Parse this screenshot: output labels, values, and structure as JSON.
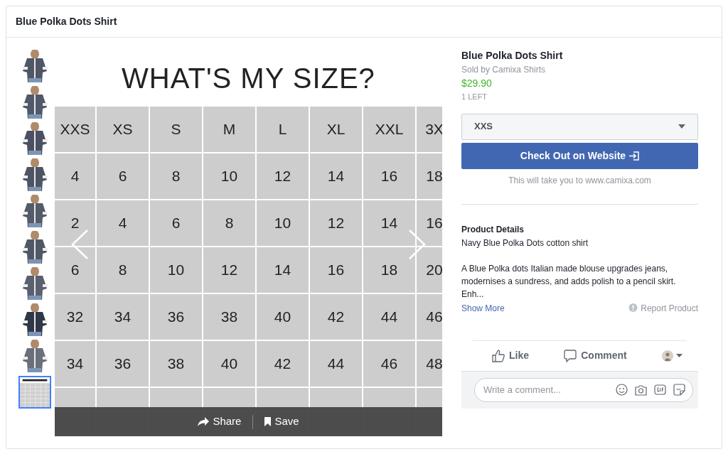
{
  "panel": {
    "title": "Blue Polka Dots Shirt"
  },
  "thumbnails": [
    {
      "kind": "picture",
      "selected": false
    },
    {
      "kind": "picture",
      "selected": false
    },
    {
      "kind": "picture",
      "selected": false
    },
    {
      "kind": "picture",
      "selected": false
    },
    {
      "kind": "picture",
      "selected": false
    },
    {
      "kind": "picture",
      "selected": false
    },
    {
      "kind": "picture",
      "selected": false
    },
    {
      "kind": "picture",
      "selected": false
    },
    {
      "kind": "picture",
      "selected": false
    },
    {
      "kind": "picture",
      "selected": true
    }
  ],
  "size_chart": {
    "title": "WHAT'S MY SIZE?",
    "rows": [
      [
        "XXS",
        "XS",
        "S",
        "M",
        "L",
        "XL",
        "XXL",
        "3X"
      ],
      [
        "4",
        "6",
        "8",
        "10",
        "12",
        "14",
        "16",
        "18"
      ],
      [
        "2",
        "4",
        "6",
        "8",
        "10",
        "12",
        "14",
        "16"
      ],
      [
        "6",
        "8",
        "10",
        "12",
        "14",
        "16",
        "18",
        "20"
      ],
      [
        "32",
        "34",
        "36",
        "38",
        "40",
        "42",
        "44",
        "46"
      ],
      [
        "34",
        "36",
        "38",
        "40",
        "42",
        "44",
        "46",
        "48"
      ]
    ]
  },
  "image_actions": [
    "Share",
    "Save"
  ],
  "product": {
    "name": "Blue Polka Dots Shirt",
    "seller": "Sold by Camixa Shirts",
    "price": "$29.90",
    "stock": "1 LEFT",
    "size_select": "XXS",
    "checkout_button": "Check Out on Website",
    "checkout_note": "This will take you to www.camixa.com",
    "details_heading": "Product Details",
    "details_subtitle": "Navy Blue Polka Dots cotton shirt",
    "description": "A Blue Polka dots Italian made blouse upgrades jeans, modernises a sundress, and adds polish to a pencil skirt. Enh...",
    "show_more": "Show More",
    "report": "Report Product"
  },
  "actions": [
    "Like",
    "Comment"
  ],
  "comment_field": {
    "placeholder": "Write a comment..."
  }
}
